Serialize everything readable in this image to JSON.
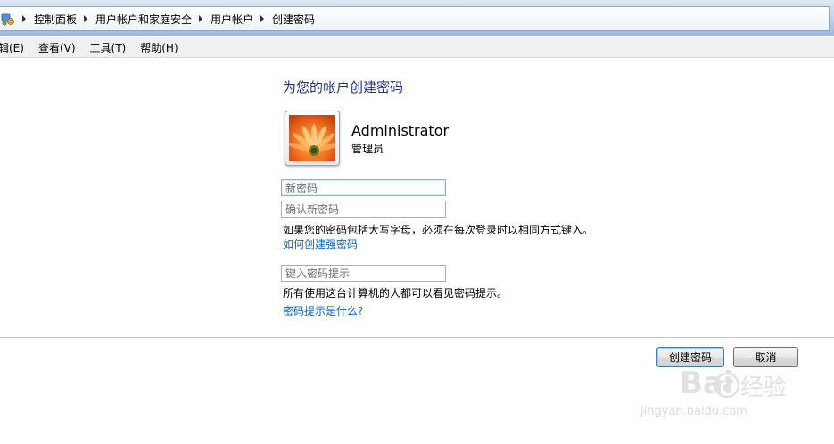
{
  "breadcrumb": {
    "items": [
      {
        "label": "控制面板"
      },
      {
        "label": "用户帐户和家庭安全"
      },
      {
        "label": "用户帐户"
      },
      {
        "label": "创建密码"
      }
    ]
  },
  "menu": {
    "items": [
      {
        "label": "辑(E)"
      },
      {
        "label": "查看(V)"
      },
      {
        "label": "工具(T)"
      },
      {
        "label": "帮助(H)"
      }
    ]
  },
  "main": {
    "title": "为您的帐户创建密码",
    "user": {
      "name": "Administrator",
      "role": "管理员"
    },
    "fields": {
      "new_password_placeholder": "新密码",
      "confirm_password_placeholder": "确认新密码",
      "hint_placeholder": "键入密码提示"
    },
    "note_case": "如果您的密码包括大写字母，必须在每次登录时以相同方式键入。",
    "link_strong": "如何创建强密码",
    "note_hint": "所有使用这台计算机的人都可以看见密码提示。",
    "link_hint": "密码提示是什么?"
  },
  "buttons": {
    "create": "创建密码",
    "cancel": "取消"
  },
  "watermark": {
    "brand_left": "Bai",
    "brand_right": "经验",
    "url": "jingyan.baidu.com"
  },
  "colors": {
    "title": "#1e3287",
    "link": "#0066cc",
    "focus_border": "#7eb4ea"
  }
}
